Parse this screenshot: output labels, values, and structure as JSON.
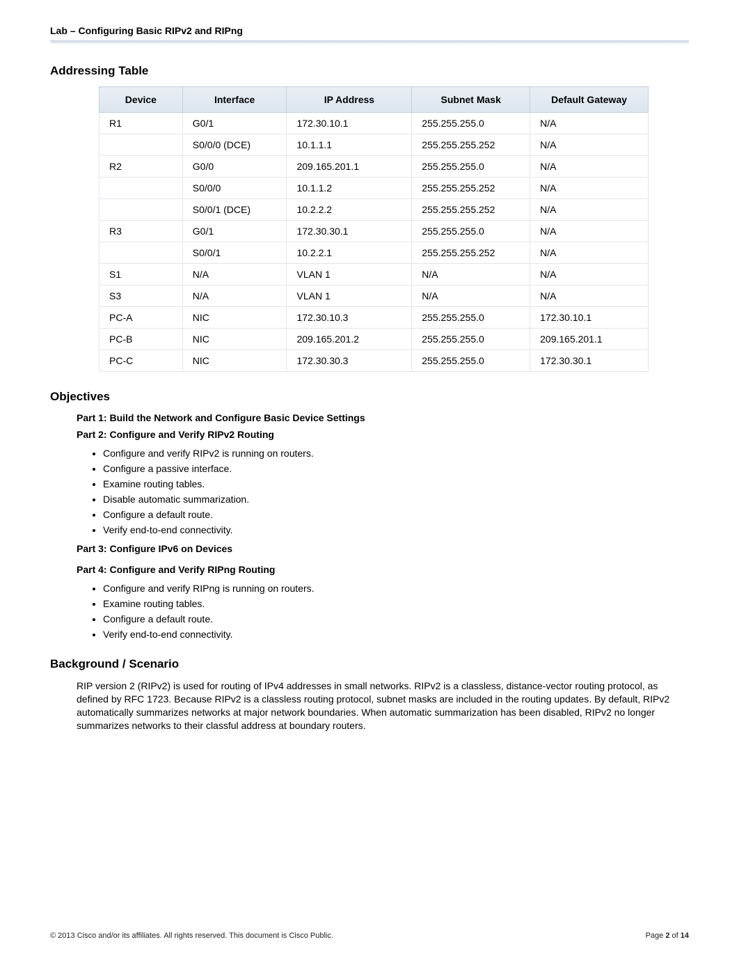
{
  "header": {
    "title": "Lab – Configuring Basic RIPv2 and RIPng"
  },
  "addressing": {
    "heading": "Addressing Table",
    "columns": [
      "Device",
      "Interface",
      "IP Address",
      "Subnet Mask",
      "Default Gateway"
    ],
    "rows": [
      {
        "device": "R1",
        "iface": "G0/1",
        "ip": "172.30.10.1",
        "mask": "255.255.255.0",
        "gw": "N/A"
      },
      {
        "device": "",
        "iface": "S0/0/0 (DCE)",
        "ip": "10.1.1.1",
        "mask": "255.255.255.252",
        "gw": "N/A"
      },
      {
        "device": "R2",
        "iface": "G0/0",
        "ip": "209.165.201.1",
        "mask": "255.255.255.0",
        "gw": "N/A"
      },
      {
        "device": "",
        "iface": "S0/0/0",
        "ip": "10.1.1.2",
        "mask": "255.255.255.252",
        "gw": "N/A"
      },
      {
        "device": "",
        "iface": "S0/0/1 (DCE)",
        "ip": "10.2.2.2",
        "mask": "255.255.255.252",
        "gw": "N/A"
      },
      {
        "device": "R3",
        "iface": "G0/1",
        "ip": "172.30.30.1",
        "mask": "255.255.255.0",
        "gw": "N/A"
      },
      {
        "device": "",
        "iface": "S0/0/1",
        "ip": "10.2.2.1",
        "mask": "255.255.255.252",
        "gw": "N/A"
      },
      {
        "device": "S1",
        "iface": "N/A",
        "ip": "VLAN 1",
        "mask": "N/A",
        "gw": "N/A"
      },
      {
        "device": "S3",
        "iface": "N/A",
        "ip": "VLAN 1",
        "mask": "N/A",
        "gw": "N/A"
      },
      {
        "device": "PC-A",
        "iface": "NIC",
        "ip": "172.30.10.3",
        "mask": "255.255.255.0",
        "gw": "172.30.10.1"
      },
      {
        "device": "PC-B",
        "iface": "NIC",
        "ip": "209.165.201.2",
        "mask": "255.255.255.0",
        "gw": "209.165.201.1"
      },
      {
        "device": "PC-C",
        "iface": "NIC",
        "ip": "172.30.30.3",
        "mask": "255.255.255.0",
        "gw": "172.30.30.1"
      }
    ]
  },
  "objectives": {
    "heading": "Objectives",
    "part1": "Part 1: Build the Network and Configure Basic Device Settings",
    "part2": "Part 2: Configure and Verify RIPv2 Routing",
    "part2_items": [
      "Configure and verify RIPv2 is running on routers.",
      "Configure a passive interface.",
      "Examine routing tables.",
      "Disable automatic summarization.",
      "Configure a default route.",
      "Verify end-to-end connectivity."
    ],
    "part3": "Part 3: Configure IPv6 on Devices",
    "part4": "Part 4: Configure and Verify RIPng Routing",
    "part4_items": [
      "Configure and verify RIPng is running on routers.",
      "Examine routing tables.",
      "Configure a default route.",
      "Verify end-to-end connectivity."
    ]
  },
  "background": {
    "heading": "Background / Scenario",
    "text": "RIP version 2 (RIPv2) is used for routing of IPv4 addresses in small networks. RIPv2 is a classless, distance-vector routing protocol, as defined by RFC 1723. Because RIPv2 is a classless routing protocol, subnet masks are included in the routing updates. By default, RIPv2 automatically summarizes networks at major network boundaries. When automatic summarization has been disabled, RIPv2 no longer summarizes networks to their classful address at boundary routers."
  },
  "footer": {
    "left": "© 2013 Cisco and/or its affiliates. All rights reserved. This document is Cisco Public.",
    "right_prefix": "Page ",
    "right_page": "2",
    "right_of": " of ",
    "right_total": "14"
  }
}
